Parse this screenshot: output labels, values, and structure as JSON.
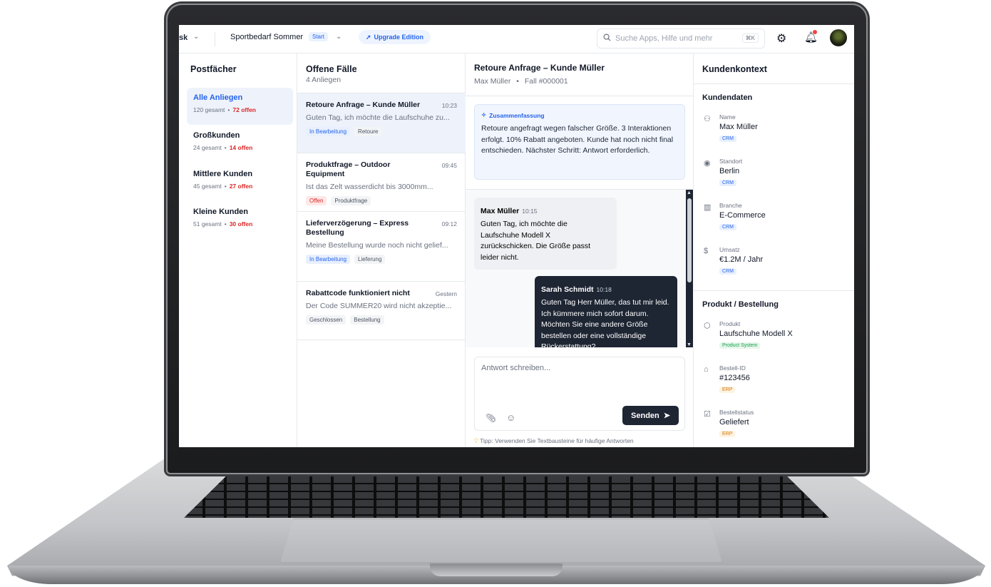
{
  "topbar": {
    "app_label": "sk",
    "company": "Sportbedarf Sommer",
    "plan": "Start",
    "upgrade_label": "Upgrade Edition",
    "search_placeholder": "Suche Apps, Hilfe und mehr",
    "search_shortcut": "⌘K"
  },
  "mailboxes": {
    "title": "Postfächer",
    "items": [
      {
        "label": "Alle Anliegen",
        "total": "120 gesamt",
        "open": "72 offen",
        "active": true
      },
      {
        "label": "Großkunden",
        "total": "24 gesamt",
        "open": "14 offen",
        "active": false
      },
      {
        "label": "Mittlere Kunden",
        "total": "45 gesamt",
        "open": "27 offen",
        "active": false
      },
      {
        "label": "Kleine Kunden",
        "total": "51 gesamt",
        "open": "30 offen",
        "active": false
      }
    ]
  },
  "cases": {
    "title": "Offene Fälle",
    "subtitle": "4 Anliegen",
    "items": [
      {
        "title": "Retoure Anfrage – Kunde Müller",
        "time": "10:23",
        "snippet": "Guten Tag, ich möchte die Laufschuhe zu...",
        "status": "In Bearbeitung",
        "category": "Retoure"
      },
      {
        "title": "Produktfrage – Outdoor Equipment",
        "time": "09:45",
        "snippet": "Ist das Zelt wasserdicht bis 3000mm...",
        "status": "Offen",
        "category": "Produktfrage"
      },
      {
        "title": "Lieferverzögerung – Express Bestellung",
        "time": "09:12",
        "snippet": "Meine Bestellung wurde noch nicht gelief...",
        "status": "In Bearbeitung",
        "category": "Lieferung"
      },
      {
        "title": "Rabattcode funktioniert nicht",
        "time": "Gestern",
        "snippet": "Der Code SUMMER20 wird nicht akzeptie...",
        "status": "Geschlossen",
        "category": "Bestellung"
      }
    ]
  },
  "conversation": {
    "title": "Retoure Anfrage – Kunde Müller",
    "customer": "Max Müller",
    "separator": "•",
    "case_id": "Fall #000001",
    "summary_title": "Zusammenfassung",
    "summary_text": "Retoure angefragt wegen falscher Größe. 3 Interaktionen erfolgt. 10% Rabatt angeboten. Kunde hat noch nicht final entschieden. Nächster Schritt: Antwort erforderlich.",
    "messages": [
      {
        "author": "Max Müller",
        "time": "10:15",
        "text": "Guten Tag, ich möchte die Laufschuhe Modell X zurückschicken. Die Größe passt leider nicht."
      },
      {
        "author": "Sarah Schmidt",
        "time": "10:18",
        "text": "Guten Tag Herr Müller, das tut mir leid. Ich kümmere mich sofort darum. Möchten Sie eine andere Größe bestellen oder eine vollständige Rückerstattung?"
      }
    ],
    "reply_placeholder": "Antwort schreiben...",
    "send_label": "Senden",
    "tip": "Tipp: Verwenden Sie Textbausteine für häufige Antworten"
  },
  "context": {
    "title": "Kundenkontext",
    "customer_section": "Kundendaten",
    "customer_fields": [
      {
        "label": "Name",
        "value": "Max Müller",
        "source": "CRM",
        "icon": "person-icon"
      },
      {
        "label": "Standort",
        "value": "Berlin",
        "source": "CRM",
        "icon": "location-pin-icon"
      },
      {
        "label": "Branche",
        "value": "E-Commerce",
        "source": "CRM",
        "icon": "building-icon"
      },
      {
        "label": "Umsatz",
        "value": "€1.2M / Jahr",
        "source": "CRM",
        "icon": "dollar-icon"
      }
    ],
    "product_section": "Produkt / Bestellung",
    "product_fields": [
      {
        "label": "Produkt",
        "value": "Laufschuhe Modell X",
        "source": "Product System",
        "icon": "box-icon"
      },
      {
        "label": "Bestell-ID",
        "value": "#123456",
        "source": "ERP",
        "icon": "tag-icon"
      },
      {
        "label": "Bestellstatus",
        "value": "Geliefert",
        "source": "ERP",
        "icon": "clipboard-check-icon"
      }
    ]
  },
  "colors": {
    "accent": "#2563eb",
    "open_red": "#dc2626",
    "dark": "#1e2533"
  }
}
